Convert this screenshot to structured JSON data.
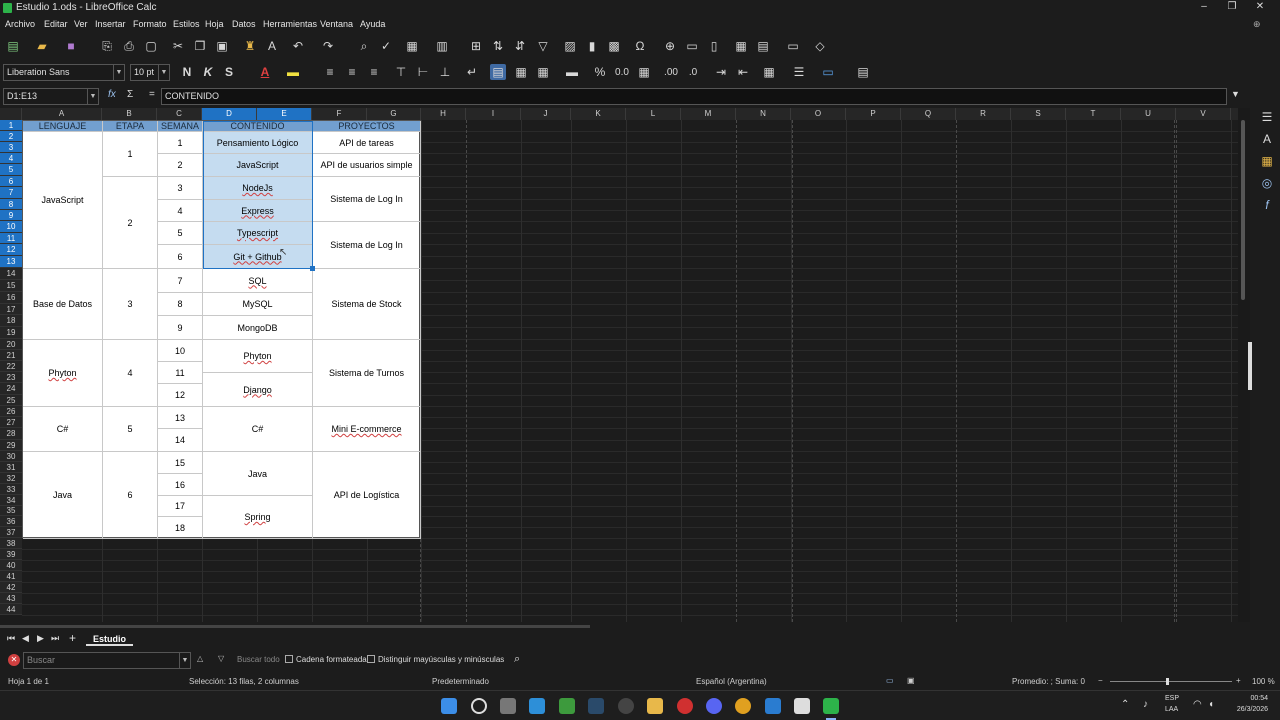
{
  "window": {
    "title": "Estudio 1.ods - LibreOffice Calc",
    "min": "–",
    "max": "❐",
    "close": "✕"
  },
  "menu": [
    "Archivo",
    "Editar",
    "Ver",
    "Insertar",
    "Formato",
    "Estilos",
    "Hoja",
    "Datos",
    "Herramientas",
    "Ventana",
    "Ayuda"
  ],
  "format_bar": {
    "font_name": "Liberation Sans",
    "font_size": "10 pt",
    "bold": "N",
    "italic": "K",
    "shadow": "S",
    "font_color": "A"
  },
  "formula_bar": {
    "name_box": "D1:E13",
    "fx": "fx",
    "sigma": "Σ",
    "equals": "=",
    "content": "CONTENIDO"
  },
  "columns": [
    "A",
    "B",
    "C",
    "D",
    "E",
    "F",
    "G",
    "H",
    "I",
    "J",
    "K",
    "L",
    "M",
    "N",
    "O",
    "P",
    "Q",
    "R",
    "S",
    "T",
    "U",
    "V"
  ],
  "rows": [
    "1",
    "2",
    "3",
    "4",
    "5",
    "6",
    "7",
    "8",
    "9",
    "10",
    "11",
    "12",
    "13",
    "14",
    "15",
    "16",
    "17",
    "18",
    "19",
    "20",
    "21",
    "22",
    "23",
    "24",
    "25",
    "26",
    "27",
    "28",
    "29",
    "30",
    "31",
    "32",
    "33",
    "34",
    "35",
    "36",
    "37",
    "38",
    "39",
    "40",
    "41",
    "42",
    "43",
    "44"
  ],
  "table": {
    "headers": {
      "lenguaje": "LENGUAJE",
      "etapa": "ETAPA",
      "semana": "SEMANA",
      "contenido": "CONTENIDO",
      "proyectos": "PROYECTOS"
    },
    "lenguajes": [
      "JavaScript",
      "Base de Datos",
      "Phyton",
      "C#",
      "Java"
    ],
    "etapas": [
      "1",
      "2",
      "3",
      "4",
      "5",
      "6"
    ],
    "semanas": [
      "1",
      "2",
      "3",
      "4",
      "5",
      "6",
      "7",
      "8",
      "9",
      "10",
      "11",
      "12",
      "13",
      "14",
      "15",
      "16",
      "17",
      "18"
    ],
    "contenidos": [
      "Pensamiento Lógico",
      "JavaScript",
      "NodeJs",
      "Express",
      "Typescript",
      "Git + Github",
      "SQL",
      "MySQL",
      "MongoDB",
      "Phyton",
      "Django",
      "C#",
      "Java",
      "Spring"
    ],
    "proyectos": [
      "API de tareas",
      "API de usuarios simple",
      "Sistema de Log In",
      "Sistema de Log In",
      "Sistema de Stock",
      "Sistema de Turnos",
      "Mini E-commerce",
      "API de Logística"
    ]
  },
  "sheet_tabs": {
    "active": "Estudio"
  },
  "find_bar": {
    "placeholder": "Buscar",
    "find_all": "Buscar todo",
    "formatted": "Cadena formateada",
    "match_case": "Distinguir mayúsculas y minúsculas"
  },
  "status": {
    "sheet": "Hoja 1 de 1",
    "selection": "Selección: 13 filas, 2 columnas",
    "style": "Predeterminado",
    "language": "Español (Argentina)",
    "sum": "Promedio: ; Suma: 0",
    "zoom": "100 %"
  },
  "taskbar": {
    "lang": "ESP",
    "layout": "LAA",
    "time": "00:54",
    "date": "26/3/2026"
  },
  "colors": {
    "header_blue": "#729fcf",
    "selection": "#c5dcf0",
    "accent": "#1f72c4"
  }
}
